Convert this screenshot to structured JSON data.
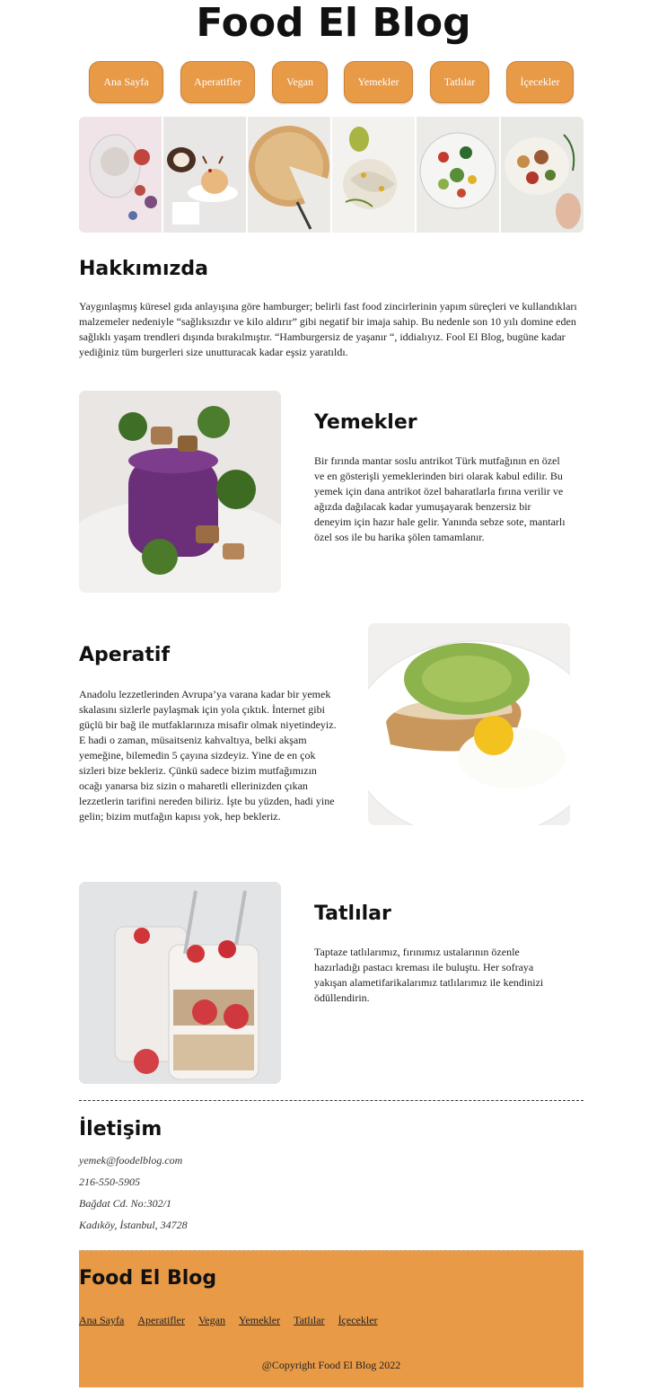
{
  "site": {
    "title": "Food El Blog"
  },
  "nav": {
    "items": [
      {
        "label": "Ana Sayfa"
      },
      {
        "label": "Aperatifler"
      },
      {
        "label": "Vegan"
      },
      {
        "label": "Yemekler"
      },
      {
        "label": "Tatlılar"
      },
      {
        "label": "İçecekler"
      }
    ]
  },
  "about": {
    "heading": "Hakkımızda",
    "text": "Yaygınlaşmış küresel gıda anlayışına göre hamburger; belirli fast food zincirlerinin yapım süreçleri ve kullandıkları malzemeler nedeniyle “sağlıksızdır ve kilo aldırır” gibi negatif bir imaja sahip. Bu nedenle son 10 yılı domine eden sağlıklı yaşam trendleri dışında bırakılmıştır. “Hamburgersiz de yaşanır “, iddialıyız. Fool El Blog, bugüne kadar yediğiniz tüm burgerleri size unutturacak kadar eşsiz yaratıldı."
  },
  "yemekler": {
    "heading": "Yemekler",
    "text": "Bir fırında mantar soslu antrikot Türk mutfağının en özel ve en gösterişli yemeklerinden biri olarak kabul edilir. Bu yemek için dana antrikot özel baharatlarla fırına verilir ve ağızda dağılacak kadar yumuşayarak benzersiz bir deneyim için hazır hale gelir. Yanında sebze sote, mantarlı özel sos ile bu harika şölen tamamlanır."
  },
  "aperatif": {
    "heading": "Aperatif",
    "text": "Anadolu lezzetlerinden Avrupa’ya varana kadar bir yemek skalasını sizlerle paylaşmak için yola çıktık. İnternet gibi güçlü bir bağ ile mutfaklarınıza misafir olmak niyetindeyiz. E hadi o zaman, müsaitseniz kahvaltıya, belki akşam yemeğine, bilemedin 5 çayına sizdeyiz. Yine de en çok sizleri bize bekleriz. Çünkü sadece bizim mutfağımızın ocağı yanarsa biz sizin o maharetli ellerinizden çıkan lezzetlerin tarifini nereden biliriz. İşte bu yüzden, hadi yine gelin; bizim mutfağın kapısı yok, hep bekleriz."
  },
  "tatlilar": {
    "heading": "Tatlılar",
    "text": "Taptaze tatlılarımız, fırınımız ustalarının özenle hazırladığı pastacı kreması ile buluştu. Her sofraya yakışan alametifarikalarımız tatlılarımız ile kendinizi ödüllendirin."
  },
  "contact": {
    "heading": "İletişim",
    "email": "yemek@foodelblog.com",
    "phone": "216-550-5905",
    "address1": "Bağdat Cd. No:302/1",
    "address2": "Kadıköy, İstanbul, 34728"
  },
  "footer": {
    "title": "Food El Blog",
    "links": [
      "Ana Sayfa",
      "Aperatifler",
      "Vegan",
      "Yemekler",
      "Tatlılar",
      "İçecekler"
    ],
    "copyright": "@Copyright Food El Blog 2022"
  },
  "colors": {
    "accent": "#e89a47",
    "text": "#222222",
    "background": "#ffffff"
  }
}
